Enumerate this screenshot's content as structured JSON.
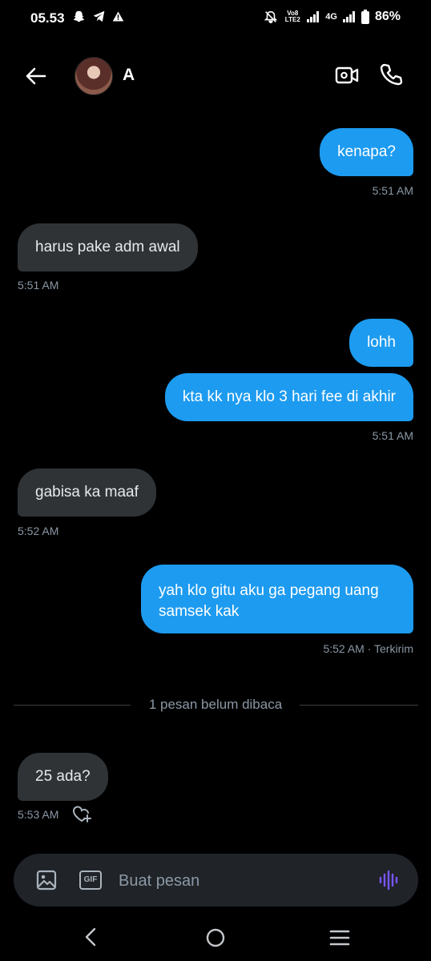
{
  "status_bar": {
    "time": "05.53",
    "volte_label": "Vo8 LTE2",
    "network_label": "4G",
    "battery": "86%",
    "icons": [
      "snapchat-icon",
      "telegram-icon",
      "alert-icon",
      "mute-icon",
      "signal-icon",
      "signal-icon",
      "battery-icon"
    ]
  },
  "header": {
    "contact_name": "A",
    "icons": [
      "back-arrow-icon",
      "video-call-icon",
      "phone-icon"
    ]
  },
  "messages": [
    {
      "direction": "sent",
      "text": "kenapa?"
    },
    {
      "direction": "received",
      "text": "harus pake adm awal"
    },
    {
      "direction": "sent",
      "text": "lohh"
    },
    {
      "direction": "sent",
      "text": "kta kk nya klo 3 hari fee di akhir"
    },
    {
      "direction": "received",
      "text": "gabisa ka maaf"
    },
    {
      "direction": "sent",
      "text": "yah klo gitu aku ga pegang uang samsek kak"
    },
    {
      "direction": "received",
      "text": "25 ada?"
    }
  ],
  "timestamps": [
    "5:51 AM",
    "5:51 AM",
    "5:51 AM",
    "5:52 AM",
    "5:52 AM · Terkirim",
    "5:53 AM"
  ],
  "unread_divider": "1 pesan belum dibaca",
  "composer": {
    "placeholder": "Buat pesan",
    "gif_label": "GIF",
    "accent": "#7856ff"
  },
  "colors": {
    "sent_bubble": "#1d9bf0",
    "received_bubble": "#2f3336",
    "background": "#000000"
  }
}
